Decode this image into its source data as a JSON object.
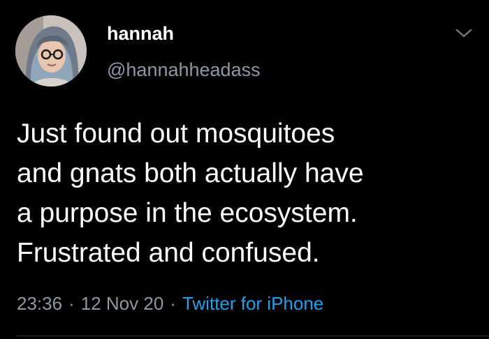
{
  "tweet": {
    "display_name": "hannah",
    "handle": "@hannahheadass",
    "text": "Just found out mosquitoes\nand gnats both actually have\na purpose in the ecosystem.\nFrustrated and confused.",
    "time": "23:36",
    "date": "12 Nov 20",
    "source": "Twitter for iPhone",
    "separator": "·"
  },
  "icons": {
    "menu": "chevron-down-icon",
    "avatar": "profile-photo"
  },
  "colors": {
    "background": "#000000",
    "text": "#ffffff",
    "muted": "#8b98a5",
    "link": "#1da1f2"
  }
}
